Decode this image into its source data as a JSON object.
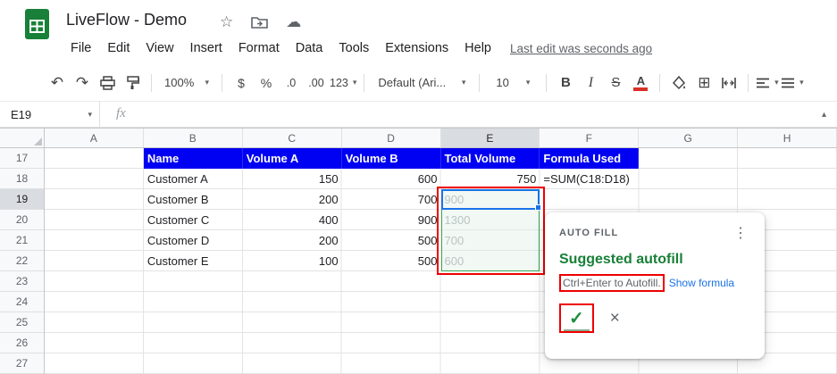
{
  "header": {
    "title": "LiveFlow - Demo",
    "menu_items": [
      "File",
      "Edit",
      "View",
      "Insert",
      "Format",
      "Data",
      "Tools",
      "Extensions",
      "Help"
    ],
    "last_edit": "Last edit was seconds ago"
  },
  "toolbar": {
    "zoom": "100%",
    "currency": "$",
    "percent": "%",
    "decrease_decimals": ".0",
    "increase_decimals": ".00",
    "more_formats": "123",
    "font": "Default (Ari...",
    "font_size": "10",
    "bold": "B",
    "italic": "I",
    "strikethrough": "S",
    "text_color": "A"
  },
  "formula_bar": {
    "cell_ref": "E19"
  },
  "sheet": {
    "col_headers": [
      "A",
      "B",
      "C",
      "D",
      "E",
      "F",
      "G",
      "H"
    ],
    "row_numbers": [
      "17",
      "18",
      "19",
      "20",
      "21",
      "22",
      "23",
      "24",
      "25",
      "26",
      "27"
    ],
    "cells": {
      "r17": {
        "b": "Name",
        "c": "Volume A",
        "d": "Volume B",
        "e": "Total Volume",
        "f": "Formula Used"
      },
      "r18": {
        "b": "Customer A",
        "c": "150",
        "d": "600",
        "e": "750",
        "f": "=SUM(C18:D18)"
      },
      "r19": {
        "b": "Customer B",
        "c": "200",
        "d": "700",
        "e": "900"
      },
      "r20": {
        "b": "Customer C",
        "c": "400",
        "d": "900",
        "e": "1300"
      },
      "r21": {
        "b": "Customer D",
        "c": "200",
        "d": "500",
        "e": "700"
      },
      "r22": {
        "b": "Customer E",
        "c": "100",
        "d": "500",
        "e": "600"
      }
    }
  },
  "autofill_popup": {
    "title": "AUTO FILL",
    "heading": "Suggested autofill",
    "hint": "Ctrl+Enter to Autofill.",
    "show_formula": "Show formula"
  },
  "icons": {
    "undo": "↶",
    "redo": "↷",
    "dropdown": "▾",
    "star": "☆",
    "cloud": "☁",
    "dots_vertical": "⋮",
    "check": "✓",
    "close": "×",
    "fx": "fx",
    "borders": "⊞",
    "collapse": "▴"
  },
  "colors": {
    "header_row_fill": "#0000f2",
    "suggestion_green": "#188038",
    "selection_blue": "#1a73e8",
    "annotation_red": "#ee0000",
    "link_blue": "#1a73e8",
    "logo_green": "#188038"
  }
}
